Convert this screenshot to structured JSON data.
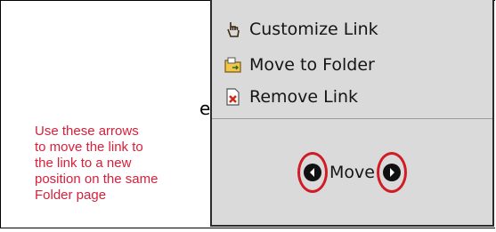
{
  "stray_char": "e",
  "note": {
    "lines": [
      "Use these arrows",
      "to move the link to",
      "the link to a new",
      "position on the same",
      "Folder page"
    ]
  },
  "menu": {
    "items": [
      {
        "label": "Customize Link",
        "icon": "pointer-hand-icon"
      },
      {
        "label": "Move to Folder",
        "icon": "folder-move-icon"
      },
      {
        "label": "Remove Link",
        "icon": "remove-link-icon"
      }
    ],
    "move_label": "Move"
  },
  "colors": {
    "annotation_red": "#d01c24",
    "note_text": "#d8203a",
    "panel_bg": "#dadada"
  }
}
